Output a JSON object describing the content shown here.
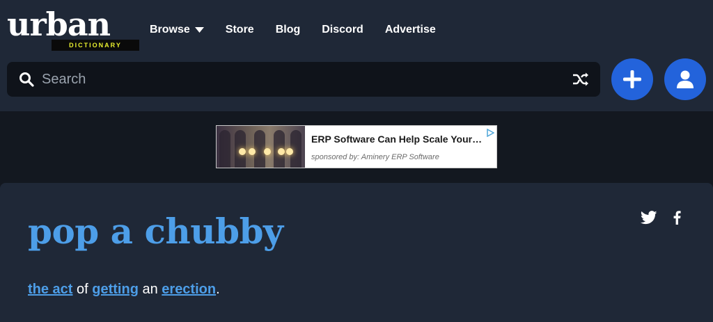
{
  "logo": {
    "word": "urban",
    "sub": "DICTIONARY"
  },
  "nav": {
    "browse": "Browse",
    "store": "Store",
    "blog": "Blog",
    "discord": "Discord",
    "advertise": "Advertise"
  },
  "search": {
    "placeholder": "Search",
    "value": ""
  },
  "ad": {
    "title": "ERP Software Can Help Scale Your…",
    "sponsor": "sponsored by: Aminery ERP Software"
  },
  "entry": {
    "word": "pop a chubby",
    "definition": {
      "link1": "the act",
      "text1": " of ",
      "link2": "getting",
      "text2": " an ",
      "link3": "erection",
      "text3": "."
    }
  },
  "colors": {
    "header_bg": "#1f2837",
    "page_bg": "#131820",
    "accent": "#2363db",
    "link": "#4d9ee8",
    "logo_sub": "#e8ef2e"
  },
  "icons": {
    "search": "search-icon",
    "shuffle": "shuffle-icon",
    "add": "plus-icon",
    "user": "user-icon",
    "twitter": "twitter-icon",
    "facebook": "facebook-icon",
    "caret": "chevron-down-icon"
  }
}
